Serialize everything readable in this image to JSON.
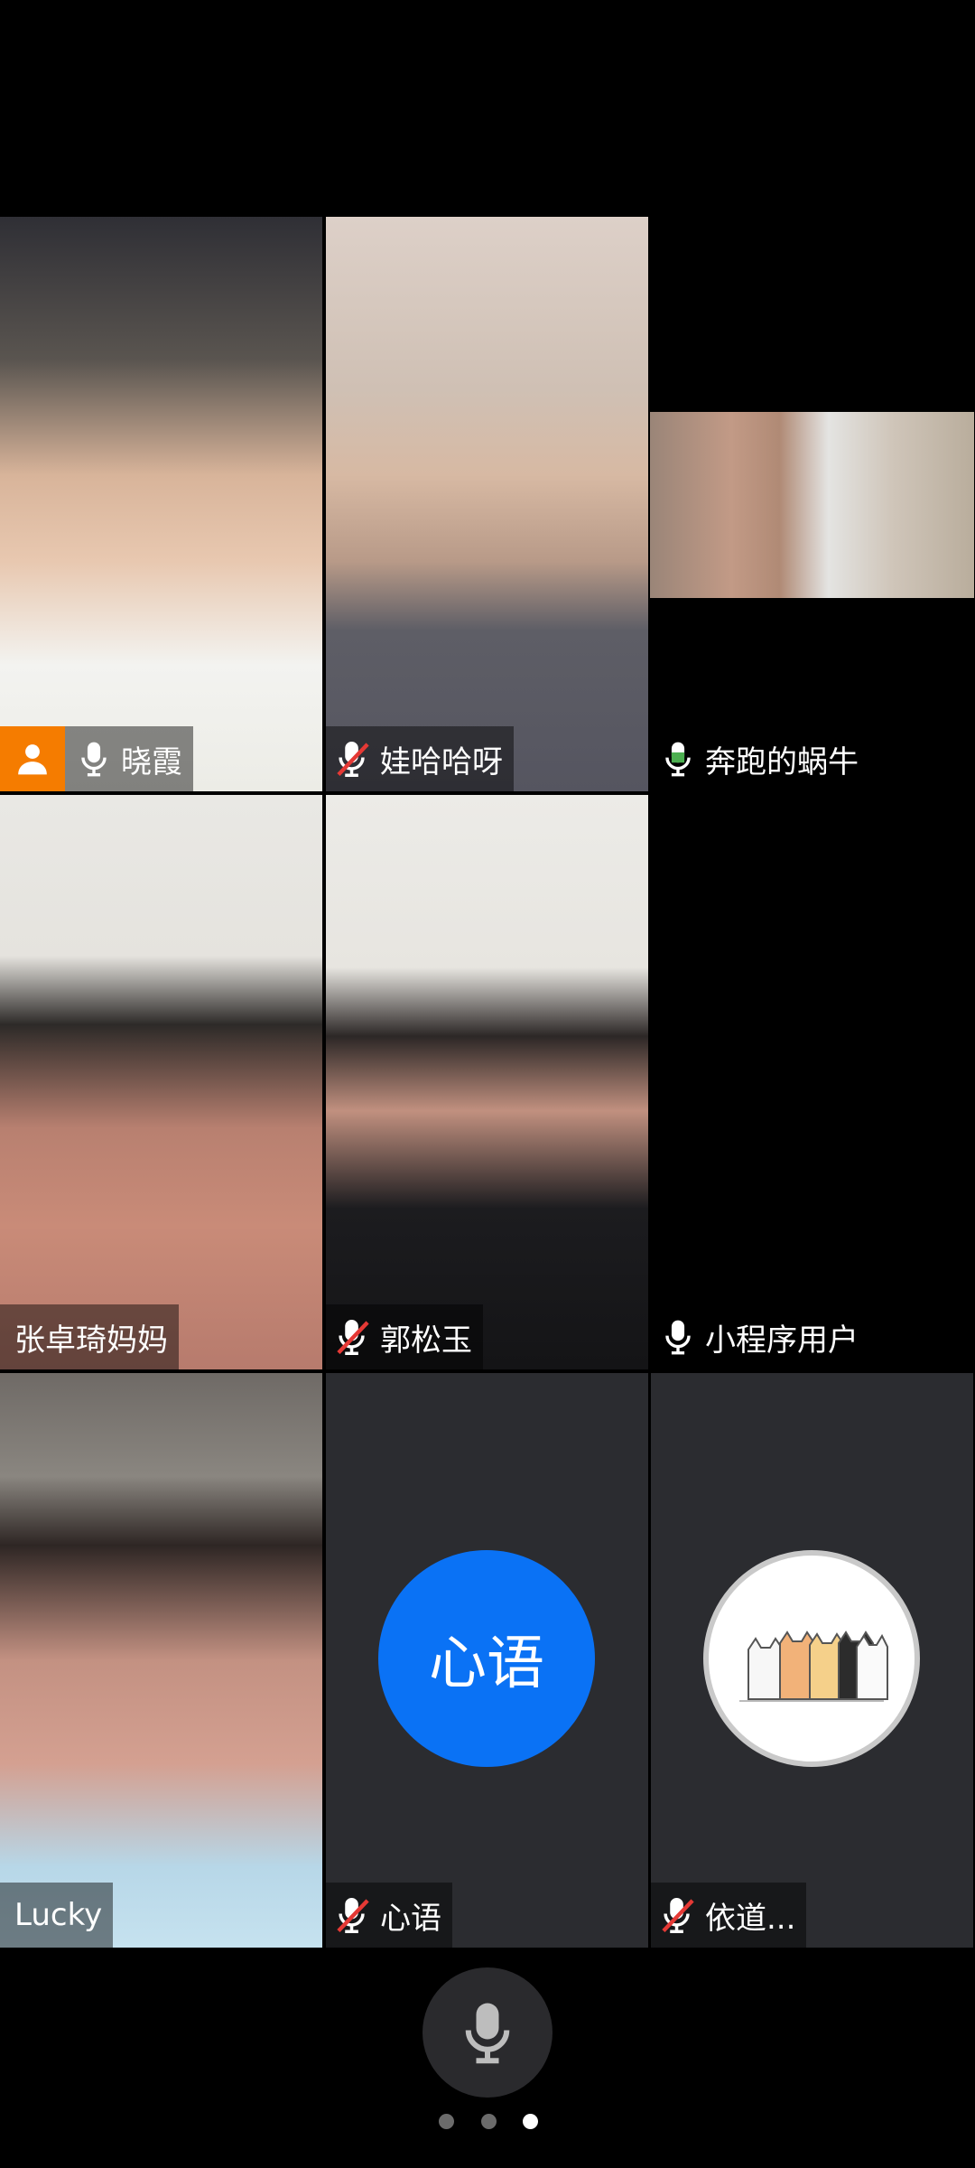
{
  "participants": [
    {
      "name": "晓霞",
      "mic": "on",
      "host": true
    },
    {
      "name": "娃哈哈呀",
      "mic": "muted"
    },
    {
      "name": "奔跑的蜗牛",
      "mic": "active"
    },
    {
      "name": "张卓琦妈妈",
      "mic": "none"
    },
    {
      "name": "郭松玉",
      "mic": "muted"
    },
    {
      "name": "小程序用户",
      "mic": "on"
    },
    {
      "name": "Lucky",
      "mic": "none"
    },
    {
      "name": "心语",
      "mic": "muted",
      "avatar_text": "心语"
    },
    {
      "name": "依道...",
      "mic": "muted"
    }
  ],
  "colors": {
    "host_badge": "#f57c00",
    "avatar_blue": "#0a72f5",
    "empty_tile": "#2b2c30",
    "mute_red": "#e53935",
    "active_mic_green": "#4caf50"
  },
  "pager": {
    "pages": 3,
    "current": 3
  }
}
